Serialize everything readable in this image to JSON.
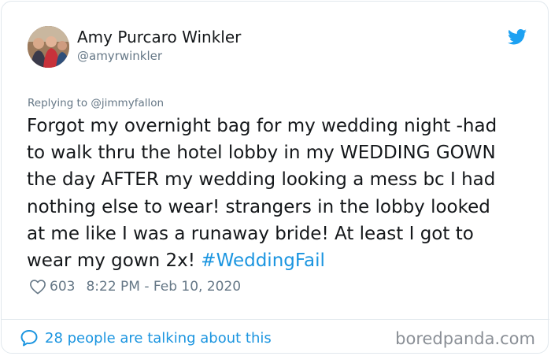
{
  "author": {
    "name": "Amy Purcaro Winkler",
    "handle": "@amyrwinkler"
  },
  "reply": {
    "prefix": "Replying to ",
    "mention": "@jimmyfallon"
  },
  "tweet": {
    "lines": [
      "Forgot my overnight bag for my wedding night -had",
      "to walk thru the hotel lobby in my WEDDING GOWN",
      "the day AFTER my wedding looking a mess bc I had",
      "nothing else to wear! strangers in the lobby looked",
      "at me like I was a runaway bride! At least I got to"
    ],
    "last_line_text": "wear my gown 2x! ",
    "hashtag": "#WeddingFail"
  },
  "meta": {
    "likes": "603",
    "timestamp": "8:22 PM - Feb 10, 2020"
  },
  "footer": {
    "talking": "28 people are talking about this",
    "watermark": "boredpanda.com"
  },
  "colors": {
    "text": "#14171a",
    "secondary": "#657786",
    "link": "#1b95e0",
    "twitter_blue": "#1da1f2",
    "border": "#e1e8ed"
  },
  "icons": {
    "brand": "twitter-bird-icon",
    "like": "heart-outline-icon",
    "talk": "speech-bubble-icon"
  }
}
